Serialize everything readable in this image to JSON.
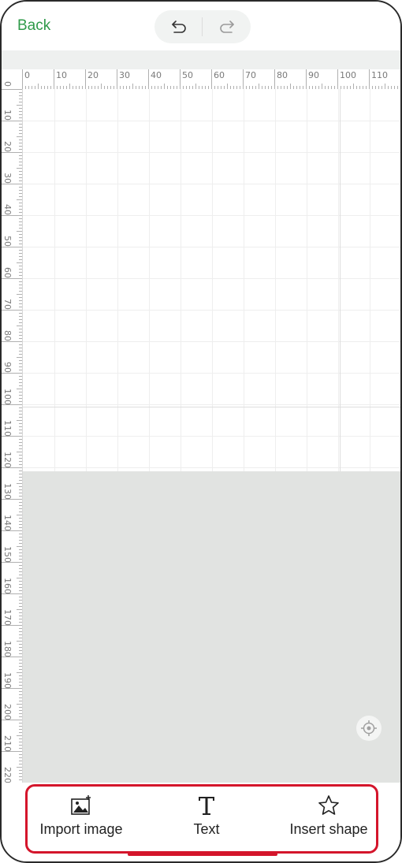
{
  "header": {
    "back_label": "Back",
    "undo_icon": "undo-icon",
    "redo_icon": "redo-icon"
  },
  "ruler": {
    "top_labels": [
      "0",
      "10",
      "20",
      "30",
      "40",
      "50",
      "60",
      "70",
      "80",
      "90",
      "100",
      "110"
    ],
    "left_labels": [
      "0",
      "10",
      "20",
      "30",
      "40",
      "50",
      "60",
      "70",
      "80",
      "90",
      "100",
      "110",
      "120",
      "130",
      "140",
      "150",
      "160",
      "170",
      "180",
      "190",
      "200",
      "210",
      "220"
    ]
  },
  "canvas": {
    "locate_icon": "locate-icon"
  },
  "toolbar": {
    "import_image_label": "Import image",
    "text_label": "Text",
    "insert_shape_label": "Insert shape"
  },
  "colors": {
    "accent_green": "#2f9a49",
    "highlight_red": "#d4152b",
    "canvas_outside": "#e1e3e1"
  }
}
